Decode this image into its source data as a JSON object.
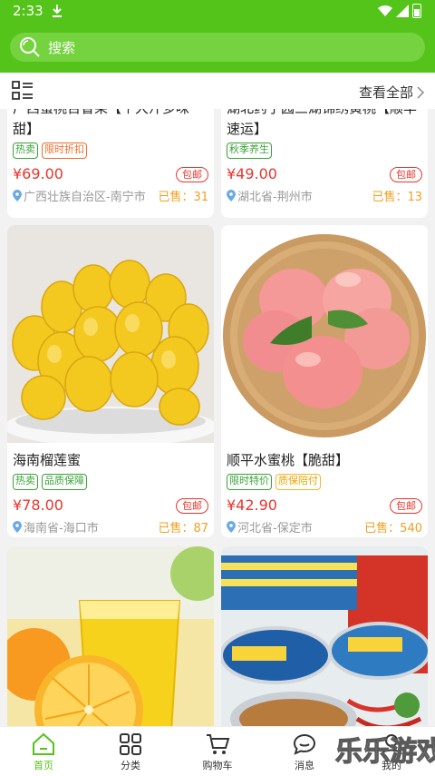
{
  "status_bar": {
    "time": "2:33"
  },
  "search": {
    "placeholder": "搜索"
  },
  "header": {
    "view_all": "查看全部"
  },
  "products": [
    {
      "title": "广西蜜桃百香果【个大汁多味甜】",
      "tags": [
        "热卖",
        "限时折扣"
      ],
      "price": "¥69.00",
      "shipping": "包邮",
      "location": "广西壮族自治区-南宁市",
      "sold": "已售：31"
    },
    {
      "title": "湖北药子园三湖锦绣黄桃【顺丰速运】",
      "tags": [
        "秋季养生"
      ],
      "price": "¥49.00",
      "shipping": "包邮",
      "location": "湖北省-荆州市",
      "sold": "已售：13"
    },
    {
      "title": "海南榴莲蜜",
      "tags": [
        "热卖",
        "品质保障"
      ],
      "price": "¥78.00",
      "shipping": "包邮",
      "location": "海南省-海口市",
      "sold": "已售：87"
    },
    {
      "title": "顺平水蜜桃【脆甜】",
      "tags": [
        "限时特价",
        "质保陪付"
      ],
      "price": "¥42.90",
      "shipping": "包邮",
      "location": "河北省-保定市",
      "sold": "已售：540"
    }
  ],
  "nav": [
    {
      "label": "首页",
      "icon": "home-icon"
    },
    {
      "label": "分类",
      "icon": "grid-icon"
    },
    {
      "label": "购物车",
      "icon": "cart-icon"
    },
    {
      "label": "消息",
      "icon": "message-icon"
    },
    {
      "label": "我的",
      "icon": "user-icon"
    }
  ],
  "watermark": {
    "text": "乐乐游戏"
  },
  "colors": {
    "brand_green": "#55c41a",
    "price_red": "#e8352b",
    "sold_orange": "#f0a020"
  }
}
